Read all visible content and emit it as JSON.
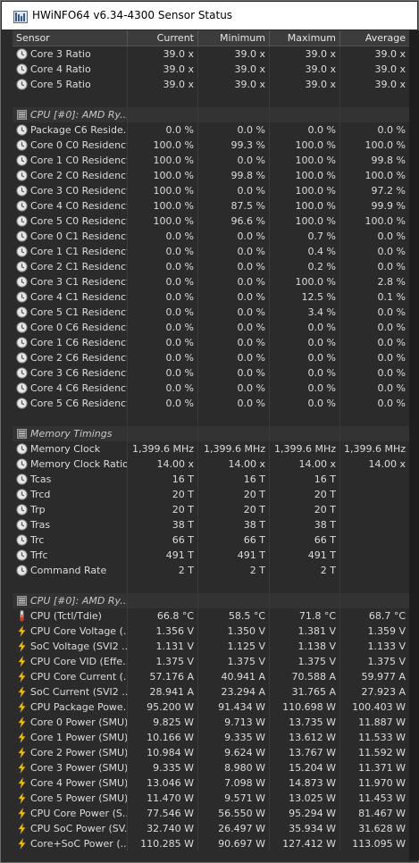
{
  "window": {
    "title": "HWiNFO64 v6.34-4300 Sensor Status"
  },
  "columns": [
    "Sensor",
    "Current",
    "Minimum",
    "Maximum",
    "Average"
  ],
  "rows": [
    {
      "kind": "sensor",
      "icon": "clock",
      "name": "Core 3 Ratio",
      "v": [
        "39.0 x",
        "39.0 x",
        "39.0 x",
        "39.0 x"
      ]
    },
    {
      "kind": "sensor",
      "icon": "clock",
      "name": "Core 4 Ratio",
      "v": [
        "39.0 x",
        "39.0 x",
        "39.0 x",
        "39.0 x"
      ]
    },
    {
      "kind": "sensor",
      "icon": "clock",
      "name": "Core 5 Ratio",
      "v": [
        "39.0 x",
        "39.0 x",
        "39.0 x",
        "39.0 x"
      ]
    },
    {
      "kind": "blank"
    },
    {
      "kind": "group",
      "name": "CPU [#0]: AMD Ry..."
    },
    {
      "kind": "sensor",
      "icon": "clock",
      "name": "Package C6 Reside...",
      "v": [
        "0.0 %",
        "0.0 %",
        "0.0 %",
        "0.0 %"
      ]
    },
    {
      "kind": "sensor",
      "icon": "clock",
      "name": "Core 0 C0 Residency",
      "v": [
        "100.0 %",
        "99.3 %",
        "100.0 %",
        "100.0 %"
      ]
    },
    {
      "kind": "sensor",
      "icon": "clock",
      "name": "Core 1 C0 Residency",
      "v": [
        "100.0 %",
        "0.0 %",
        "100.0 %",
        "99.8 %"
      ]
    },
    {
      "kind": "sensor",
      "icon": "clock",
      "name": "Core 2 C0 Residency",
      "v": [
        "100.0 %",
        "99.8 %",
        "100.0 %",
        "100.0 %"
      ]
    },
    {
      "kind": "sensor",
      "icon": "clock",
      "name": "Core 3 C0 Residency",
      "v": [
        "100.0 %",
        "0.0 %",
        "100.0 %",
        "97.2 %"
      ]
    },
    {
      "kind": "sensor",
      "icon": "clock",
      "name": "Core 4 C0 Residency",
      "v": [
        "100.0 %",
        "87.5 %",
        "100.0 %",
        "99.9 %"
      ]
    },
    {
      "kind": "sensor",
      "icon": "clock",
      "name": "Core 5 C0 Residency",
      "v": [
        "100.0 %",
        "96.6 %",
        "100.0 %",
        "100.0 %"
      ]
    },
    {
      "kind": "sensor",
      "icon": "clock",
      "name": "Core 0 C1 Residency",
      "v": [
        "0.0 %",
        "0.0 %",
        "0.7 %",
        "0.0 %"
      ]
    },
    {
      "kind": "sensor",
      "icon": "clock",
      "name": "Core 1 C1 Residency",
      "v": [
        "0.0 %",
        "0.0 %",
        "0.4 %",
        "0.0 %"
      ]
    },
    {
      "kind": "sensor",
      "icon": "clock",
      "name": "Core 2 C1 Residency",
      "v": [
        "0.0 %",
        "0.0 %",
        "0.2 %",
        "0.0 %"
      ]
    },
    {
      "kind": "sensor",
      "icon": "clock",
      "name": "Core 3 C1 Residency",
      "v": [
        "0.0 %",
        "0.0 %",
        "100.0 %",
        "2.8 %"
      ]
    },
    {
      "kind": "sensor",
      "icon": "clock",
      "name": "Core 4 C1 Residency",
      "v": [
        "0.0 %",
        "0.0 %",
        "12.5 %",
        "0.1 %"
      ]
    },
    {
      "kind": "sensor",
      "icon": "clock",
      "name": "Core 5 C1 Residency",
      "v": [
        "0.0 %",
        "0.0 %",
        "3.4 %",
        "0.0 %"
      ]
    },
    {
      "kind": "sensor",
      "icon": "clock",
      "name": "Core 0 C6 Residency",
      "v": [
        "0.0 %",
        "0.0 %",
        "0.0 %",
        "0.0 %"
      ]
    },
    {
      "kind": "sensor",
      "icon": "clock",
      "name": "Core 1 C6 Residency",
      "v": [
        "0.0 %",
        "0.0 %",
        "0.0 %",
        "0.0 %"
      ]
    },
    {
      "kind": "sensor",
      "icon": "clock",
      "name": "Core 2 C6 Residency",
      "v": [
        "0.0 %",
        "0.0 %",
        "0.0 %",
        "0.0 %"
      ]
    },
    {
      "kind": "sensor",
      "icon": "clock",
      "name": "Core 3 C6 Residency",
      "v": [
        "0.0 %",
        "0.0 %",
        "0.0 %",
        "0.0 %"
      ]
    },
    {
      "kind": "sensor",
      "icon": "clock",
      "name": "Core 4 C6 Residency",
      "v": [
        "0.0 %",
        "0.0 %",
        "0.0 %",
        "0.0 %"
      ]
    },
    {
      "kind": "sensor",
      "icon": "clock",
      "name": "Core 5 C6 Residency",
      "v": [
        "0.0 %",
        "0.0 %",
        "0.0 %",
        "0.0 %"
      ]
    },
    {
      "kind": "blank"
    },
    {
      "kind": "group",
      "name": "Memory Timings"
    },
    {
      "kind": "sensor",
      "icon": "clock",
      "name": "Memory Clock",
      "v": [
        "1,399.6 MHz",
        "1,399.6 MHz",
        "1,399.6 MHz",
        "1,399.6 MHz"
      ]
    },
    {
      "kind": "sensor",
      "icon": "clock",
      "name": "Memory Clock Ratio",
      "v": [
        "14.00 x",
        "14.00 x",
        "14.00 x",
        "14.00 x"
      ]
    },
    {
      "kind": "sensor",
      "icon": "clock",
      "name": "Tcas",
      "v": [
        "16 T",
        "16 T",
        "16 T",
        ""
      ]
    },
    {
      "kind": "sensor",
      "icon": "clock",
      "name": "Trcd",
      "v": [
        "20 T",
        "20 T",
        "20 T",
        ""
      ]
    },
    {
      "kind": "sensor",
      "icon": "clock",
      "name": "Trp",
      "v": [
        "20 T",
        "20 T",
        "20 T",
        ""
      ]
    },
    {
      "kind": "sensor",
      "icon": "clock",
      "name": "Tras",
      "v": [
        "38 T",
        "38 T",
        "38 T",
        ""
      ]
    },
    {
      "kind": "sensor",
      "icon": "clock",
      "name": "Trc",
      "v": [
        "66 T",
        "66 T",
        "66 T",
        ""
      ]
    },
    {
      "kind": "sensor",
      "icon": "clock",
      "name": "Trfc",
      "v": [
        "491 T",
        "491 T",
        "491 T",
        ""
      ]
    },
    {
      "kind": "sensor",
      "icon": "clock",
      "name": "Command Rate",
      "v": [
        "2 T",
        "2 T",
        "2 T",
        ""
      ]
    },
    {
      "kind": "blank"
    },
    {
      "kind": "group",
      "name": "CPU [#0]: AMD Ry..."
    },
    {
      "kind": "sensor",
      "icon": "thermometer",
      "name": "CPU (Tctl/Tdie)",
      "v": [
        "66.8 °C",
        "58.5 °C",
        "71.8 °C",
        "68.7 °C"
      ]
    },
    {
      "kind": "sensor",
      "icon": "bolt",
      "name": "CPU Core Voltage (...",
      "v": [
        "1.356 V",
        "1.350 V",
        "1.381 V",
        "1.359 V"
      ]
    },
    {
      "kind": "sensor",
      "icon": "bolt",
      "name": "SoC Voltage (SVI2 ...",
      "v": [
        "1.131 V",
        "1.125 V",
        "1.138 V",
        "1.133 V"
      ]
    },
    {
      "kind": "sensor",
      "icon": "bolt",
      "name": "CPU Core VID (Effe...",
      "v": [
        "1.375 V",
        "1.375 V",
        "1.375 V",
        "1.375 V"
      ]
    },
    {
      "kind": "sensor",
      "icon": "bolt",
      "name": "CPU Core Current (...",
      "v": [
        "57.176 A",
        "40.941 A",
        "70.588 A",
        "59.977 A"
      ]
    },
    {
      "kind": "sensor",
      "icon": "bolt",
      "name": "SoC Current (SVI2 ...",
      "v": [
        "28.941 A",
        "23.294 A",
        "31.765 A",
        "27.923 A"
      ]
    },
    {
      "kind": "sensor",
      "icon": "bolt",
      "name": "CPU Package Powe...",
      "v": [
        "95.200 W",
        "91.434 W",
        "110.698 W",
        "100.403 W"
      ]
    },
    {
      "kind": "sensor",
      "icon": "bolt",
      "name": "Core 0 Power (SMU)",
      "v": [
        "9.825 W",
        "9.713 W",
        "13.735 W",
        "11.887 W"
      ]
    },
    {
      "kind": "sensor",
      "icon": "bolt",
      "name": "Core 1 Power (SMU)",
      "v": [
        "10.166 W",
        "9.335 W",
        "13.612 W",
        "11.533 W"
      ]
    },
    {
      "kind": "sensor",
      "icon": "bolt",
      "name": "Core 2 Power (SMU)",
      "v": [
        "10.984 W",
        "9.624 W",
        "13.767 W",
        "11.592 W"
      ]
    },
    {
      "kind": "sensor",
      "icon": "bolt",
      "name": "Core 3 Power (SMU)",
      "v": [
        "9.335 W",
        "8.980 W",
        "15.204 W",
        "11.371 W"
      ]
    },
    {
      "kind": "sensor",
      "icon": "bolt",
      "name": "Core 4 Power (SMU)",
      "v": [
        "13.046 W",
        "7.098 W",
        "14.873 W",
        "11.970 W"
      ]
    },
    {
      "kind": "sensor",
      "icon": "bolt",
      "name": "Core 5 Power (SMU)",
      "v": [
        "11.470 W",
        "9.571 W",
        "13.025 W",
        "11.453 W"
      ]
    },
    {
      "kind": "sensor",
      "icon": "bolt",
      "name": "CPU Core Power (S...",
      "v": [
        "77.546 W",
        "56.550 W",
        "95.294 W",
        "81.467 W"
      ]
    },
    {
      "kind": "sensor",
      "icon": "bolt",
      "name": "CPU SoC Power (SV...",
      "v": [
        "32.740 W",
        "26.497 W",
        "35.934 W",
        "31.628 W"
      ]
    },
    {
      "kind": "sensor",
      "icon": "bolt",
      "name": "Core+SoC Power (...",
      "v": [
        "110.285 W",
        "90.697 W",
        "127.412 W",
        "113.095 W"
      ]
    }
  ]
}
